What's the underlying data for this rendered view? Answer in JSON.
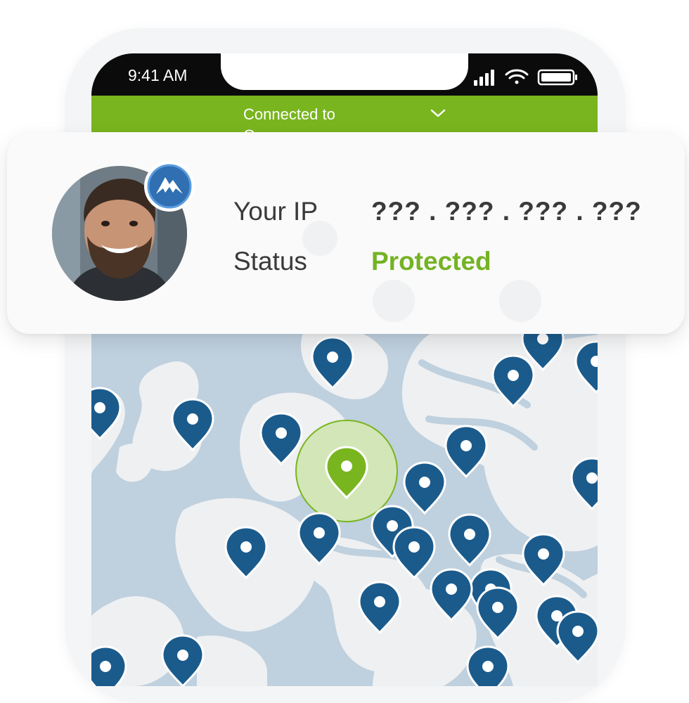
{
  "statusbar": {
    "time": "9:41 AM",
    "icons": [
      "signal-icon",
      "wifi-icon",
      "battery-icon"
    ]
  },
  "connection": {
    "label_line1": "Connected to",
    "label_line2": "Germany",
    "icon": "chevron-down-icon"
  },
  "card": {
    "ip_label": "Your IP",
    "ip_value": "??? . ??? . ??? . ???",
    "status_label": "Status",
    "status_value": "Protected",
    "badge_icon": "mountain-logo-icon"
  },
  "colors": {
    "accent_green": "#79b51f",
    "protected_green": "#74b323",
    "pin_blue": "#1b5b8c",
    "map_water": "#bfd0de",
    "map_land": "#eef0f2"
  }
}
